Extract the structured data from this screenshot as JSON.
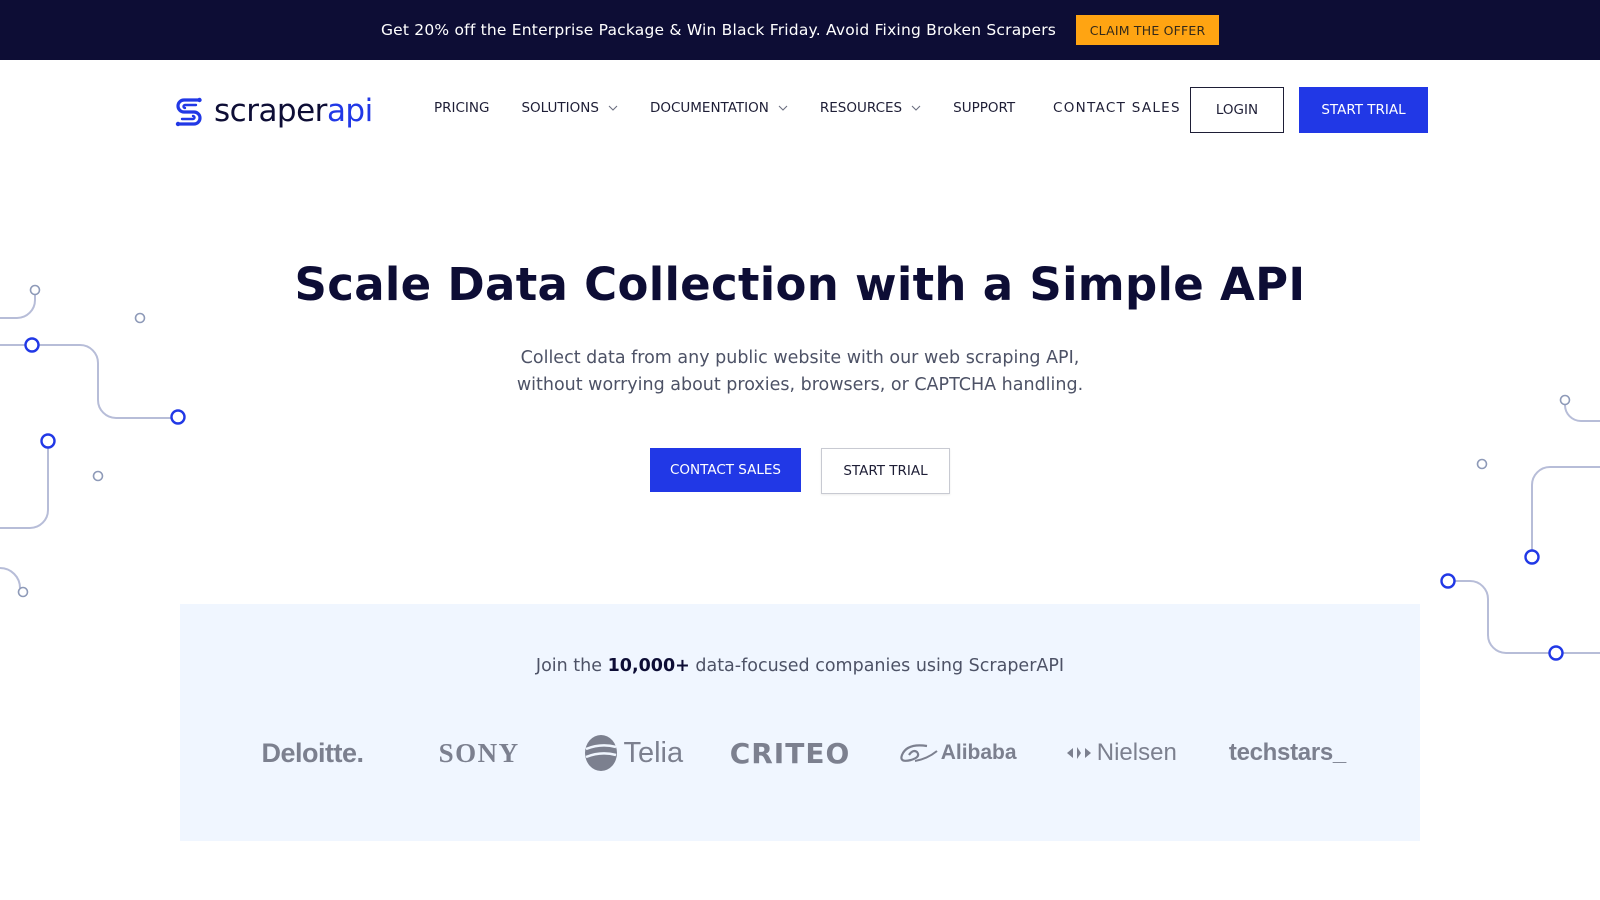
{
  "promo": {
    "text": "Get 20% off the Enterprise Package & Win Black Friday. Avoid Fixing Broken Scrapers",
    "button_label": "CLAIM THE OFFER"
  },
  "brand": {
    "name_primary": "scraper",
    "name_accent": "api"
  },
  "nav": {
    "items": [
      {
        "label": "PRICING",
        "has_dropdown": false
      },
      {
        "label": "SOLUTIONS",
        "has_dropdown": true
      },
      {
        "label": "DOCUMENTATION",
        "has_dropdown": true
      },
      {
        "label": "RESOURCES",
        "has_dropdown": true
      },
      {
        "label": "SUPPORT",
        "has_dropdown": false
      }
    ],
    "contact_label": "CONTACT SALES",
    "login_label": "LOGIN",
    "trial_label": "START TRIAL"
  },
  "hero": {
    "title": "Scale Data Collection with a Simple API",
    "subtitle_line1": "Collect data from any public website with our web scraping API,",
    "subtitle_line2": "without worrying about proxies, browsers, or CAPTCHA handling.",
    "primary_cta": "CONTACT SALES",
    "secondary_cta": "START TRIAL"
  },
  "trust": {
    "prefix": "Join the ",
    "count": "10,000+",
    "suffix": " data-focused companies using ScraperAPI",
    "logos": [
      "Deloitte.",
      "SONY",
      "Telia",
      "CRITEO",
      "Alibaba",
      "Nielsen",
      "techstars_"
    ]
  },
  "colors": {
    "accent": "#2138e6",
    "promo_bg": "#0d0d35",
    "promo_button": "#ffa412",
    "panel_bg": "#f0f6ff",
    "logo_gray": "#7c808f"
  }
}
